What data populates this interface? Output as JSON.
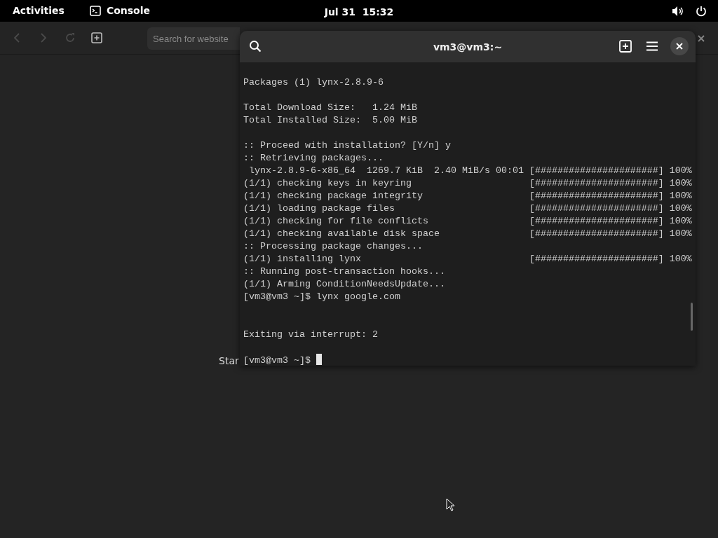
{
  "top_bar": {
    "activities": "Activities",
    "app": "Console",
    "clock": "Jul 31  15:32"
  },
  "browser": {
    "search": {
      "placeholder": "Search for website"
    },
    "page_text": "Star"
  },
  "terminal": {
    "title": "vm3@vm3:~",
    "lines": [
      {
        "text": "Packages (1) lynx-2.8.9-6"
      },
      {
        "text": "Total Download Size:   1.24 MiB",
        "blank_before": true
      },
      {
        "text": "Total Installed Size:  5.00 MiB"
      },
      {
        "text": ":: Proceed with installation? [Y/n] y",
        "blank_before": true
      },
      {
        "text": ":: Retrieving packages..."
      },
      {
        "text": " lynx-2.8.9-6-x86_64  1269.7 KiB  2.40 MiB/s 00:01 [######################] 100%"
      },
      {
        "text": "(1/1) checking keys in keyring                     [######################] 100%"
      },
      {
        "text": "(1/1) checking package integrity                   [######################] 100%"
      },
      {
        "text": "(1/1) loading package files                        [######################] 100%"
      },
      {
        "text": "(1/1) checking for file conflicts                  [######################] 100%"
      },
      {
        "text": "(1/1) checking available disk space                [######################] 100%"
      },
      {
        "text": ":: Processing package changes..."
      },
      {
        "text": "(1/1) installing lynx                              [######################] 100%"
      },
      {
        "text": ":: Running post-transaction hooks..."
      },
      {
        "text": "(1/1) Arming ConditionNeedsUpdate..."
      },
      {
        "text": "[vm3@vm3 ~]$ lynx google.com"
      },
      {
        "text": "Exiting via interrupt: 2",
        "blank_before": true,
        "double_blank": true
      },
      {
        "text": "[vm3@vm3 ~]$",
        "blank_before": true,
        "cursor": true
      }
    ]
  }
}
